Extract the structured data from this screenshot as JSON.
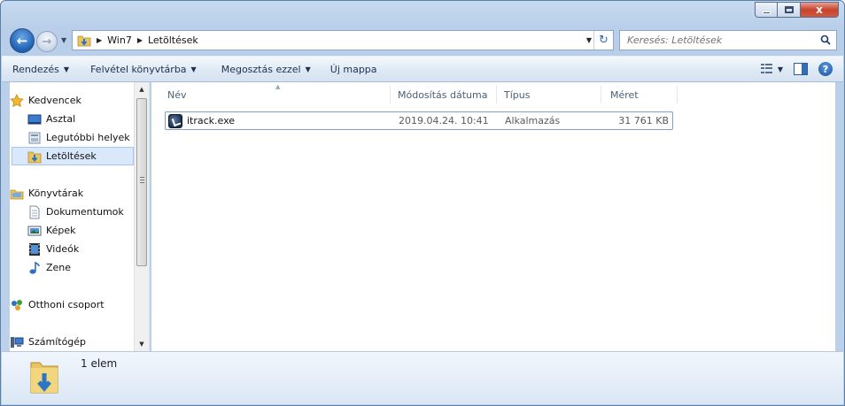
{
  "window": {
    "caption_buttons": {
      "minimize_icon": "minimize-icon",
      "maximize_icon": "maximize-icon",
      "close_icon": "close-icon",
      "close_glyph": "x"
    }
  },
  "navigation": {
    "back_icon": "back-arrow-icon",
    "back_glyph": "←",
    "forward_icon": "forward-arrow-icon",
    "forward_glyph": "→",
    "recent_icon": "chevron-down-icon",
    "recent_glyph": "▼"
  },
  "address_bar": {
    "separator_glyph": "▶",
    "dropdown_glyph": "▼",
    "refresh_glyph": "↻",
    "crumbs": [
      "Win7",
      "Letöltések"
    ]
  },
  "search": {
    "placeholder": "Keresés: Letöltések",
    "icon": "search-icon"
  },
  "command_bar": {
    "dropdown_glyph": "▼",
    "organize": "Rendezés",
    "add_to_library": "Felvétel könyvtárba",
    "share_with": "Megosztás ezzel",
    "new_folder": "Új mappa",
    "view_icon": "view-options-icon",
    "preview_pane_icon": "preview-pane-icon",
    "help_icon": "help-icon",
    "help_glyph": "?"
  },
  "nav_pane": {
    "scroll_up_glyph": "▲",
    "scroll_down_glyph": "▼",
    "items": [
      {
        "label": "Kedvencek",
        "icon": "star-icon"
      },
      {
        "label": "Asztal",
        "icon": "desktop-icon"
      },
      {
        "label": "Legutóbbi helyek",
        "icon": "recent-places-icon"
      },
      {
        "label": "Letöltések",
        "icon": "downloads-folder-icon",
        "selected": true
      },
      {
        "label": "Könyvtárak",
        "icon": "libraries-icon"
      },
      {
        "label": "Dokumentumok",
        "icon": "documents-icon"
      },
      {
        "label": "Képek",
        "icon": "pictures-icon"
      },
      {
        "label": "Videók",
        "icon": "videos-icon"
      },
      {
        "label": "Zene",
        "icon": "music-icon"
      },
      {
        "label": "Otthoni csoport",
        "icon": "homegroup-icon"
      },
      {
        "label": "Számítógép",
        "icon": "computer-icon"
      }
    ]
  },
  "file_list": {
    "sort_glyph": "▲",
    "columns": [
      "Név",
      "Módosítás dátuma",
      "Típus",
      "Méret"
    ],
    "rows": [
      {
        "name": "itrack.exe",
        "modified": "2019.04.24. 10:41",
        "type": "Alkalmazás",
        "size": "31 761 KB",
        "icon": "application-icon"
      }
    ]
  },
  "details_pane": {
    "count": "1 elem",
    "icon": "downloads-folder-large-icon"
  },
  "colors": {
    "selection": "#d9e8fb",
    "accent": "#2f6bb5"
  }
}
